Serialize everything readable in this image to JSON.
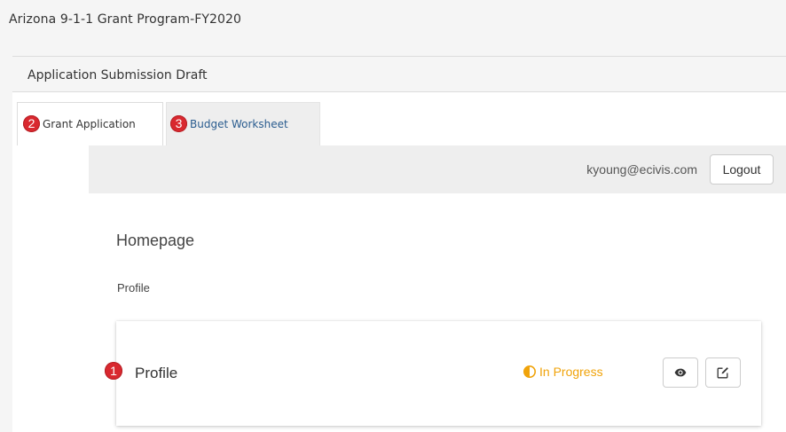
{
  "header": {
    "program_title": "Arizona 9-1-1 Grant Program-FY2020"
  },
  "panel": {
    "heading": "Application Submission Draft"
  },
  "tabs": [
    {
      "badge": "2",
      "label": "Grant Application",
      "active": true
    },
    {
      "badge": "3",
      "label": "Budget Worksheet",
      "active": false
    }
  ],
  "topbar": {
    "user_email": "kyoung@ecivis.com",
    "logout_label": "Logout"
  },
  "main": {
    "page_title": "Homepage",
    "section_label": "Profile"
  },
  "card": {
    "badge": "1",
    "title": "Profile",
    "status": "In Progress",
    "status_icon": "half-circle-icon",
    "view_icon": "eye-icon",
    "edit_icon": "edit-icon"
  },
  "colors": {
    "badge": "#d9282f",
    "status": "#f0a30a",
    "link": "#2a5c8f",
    "topbar": "#eeeeee"
  }
}
